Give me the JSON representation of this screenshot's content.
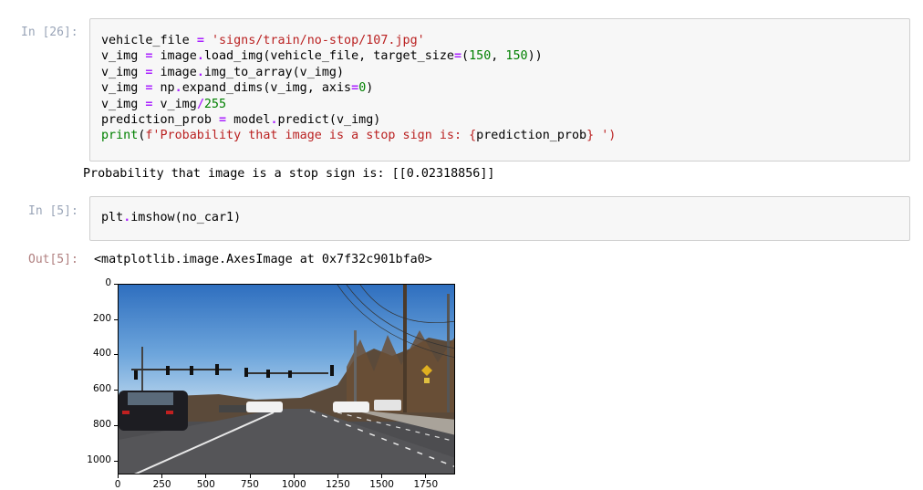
{
  "cells": [
    {
      "prompt": "In [26]:",
      "code_lines": [
        [
          [
            "vehicle_file ",
            ""
          ],
          [
            "=",
            "op"
          ],
          [
            " ",
            ""
          ],
          [
            "'signs/train/no-stop/107.jpg'",
            "str"
          ]
        ],
        [
          [
            "v_img ",
            ""
          ],
          [
            "=",
            "op"
          ],
          [
            " image",
            ""
          ],
          [
            ".",
            "op"
          ],
          [
            "load_img(vehicle_file, target_size",
            ""
          ],
          [
            "=",
            "op"
          ],
          [
            "(",
            ""
          ],
          [
            "150",
            "num"
          ],
          [
            ", ",
            ""
          ],
          [
            "150",
            "num"
          ],
          [
            "))",
            ""
          ]
        ],
        [
          [
            "v_img ",
            ""
          ],
          [
            "=",
            "op"
          ],
          [
            " image",
            ""
          ],
          [
            ".",
            "op"
          ],
          [
            "img_to_array(v_img)",
            ""
          ]
        ],
        [
          [
            "v_img ",
            ""
          ],
          [
            "=",
            "op"
          ],
          [
            " np",
            ""
          ],
          [
            ".",
            "op"
          ],
          [
            "expand_dims(v_img, axis",
            ""
          ],
          [
            "=",
            "op"
          ],
          [
            "0",
            "num"
          ],
          [
            ")",
            ""
          ]
        ],
        [
          [
            "v_img ",
            ""
          ],
          [
            "=",
            "op"
          ],
          [
            " v_img",
            ""
          ],
          [
            "/",
            "op"
          ],
          [
            "255",
            "num"
          ]
        ],
        [
          [
            "prediction_prob ",
            ""
          ],
          [
            "=",
            "op"
          ],
          [
            " model",
            ""
          ],
          [
            ".",
            "op"
          ],
          [
            "predict(v_img)",
            ""
          ]
        ],
        [
          [
            "print",
            "fn"
          ],
          [
            "(",
            ""
          ],
          [
            "f'Probability that image is a stop sign is: ",
            "str"
          ],
          [
            "{",
            "str"
          ],
          [
            "prediction_prob",
            ""
          ],
          [
            "}",
            "str"
          ],
          [
            " ')",
            "str"
          ]
        ]
      ],
      "output": "Probability that image is a stop sign is: [[0.02318856]]"
    },
    {
      "prompt": "In [5]:",
      "code_lines": [
        [
          [
            "plt",
            ""
          ],
          [
            ".",
            "op"
          ],
          [
            "imshow(no_car1)",
            ""
          ]
        ]
      ],
      "out_prompt": "Out[5]:",
      "output": "<matplotlib.image.AxesImage at 0x7f32c901bfa0>"
    }
  ],
  "plot": {
    "y_ticks": [
      "0",
      "200",
      "400",
      "600",
      "800",
      "1000"
    ],
    "x_ticks": [
      "0",
      "250",
      "500",
      "750",
      "1000",
      "1250",
      "1500",
      "1750"
    ],
    "image_description_colors": {
      "sky_top": "#3f7ec8",
      "sky_bottom": "#b9d6ee",
      "road": "#4a4a4c",
      "trees": "#5a4330"
    }
  },
  "colors": {
    "cell_bg": "#f7f7f7",
    "cell_border": "#cfcfcf",
    "in_prompt": "#9aa5b8",
    "out_prompt": "#b07f7f"
  }
}
